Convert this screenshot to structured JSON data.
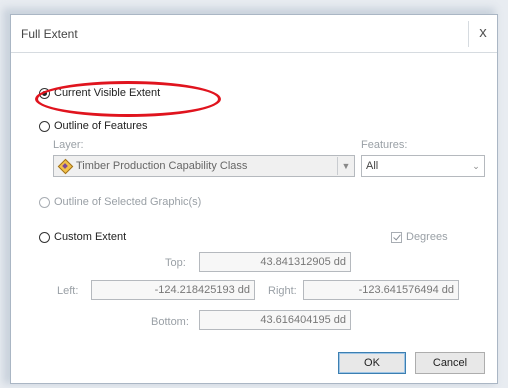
{
  "dialog": {
    "title": "Full Extent",
    "close_glyph": "x"
  },
  "options": {
    "current_visible": "Current Visible Extent",
    "outline_features": "Outline of Features",
    "outline_selected": "Outline of Selected Graphic(s)",
    "custom_extent": "Custom Extent"
  },
  "layer": {
    "label": "Layer:",
    "value": "Timber Production Capability Class",
    "icon": "layer-diamond-icon"
  },
  "features": {
    "label": "Features:",
    "value": "All"
  },
  "degrees": {
    "label": "Degrees",
    "checked": true
  },
  "extent": {
    "top_label": "Top:",
    "top_value": "43.841312905 dd",
    "left_label": "Left:",
    "left_value": "-124.218425193 dd",
    "right_label": "Right:",
    "right_value": "-123.641576494 dd",
    "bottom_label": "Bottom:",
    "bottom_value": "43.616404195 dd"
  },
  "buttons": {
    "ok": "OK",
    "cancel": "Cancel"
  },
  "colors": {
    "highlight_ring": "#e0141e",
    "default_button_border": "#3c7fb1"
  }
}
